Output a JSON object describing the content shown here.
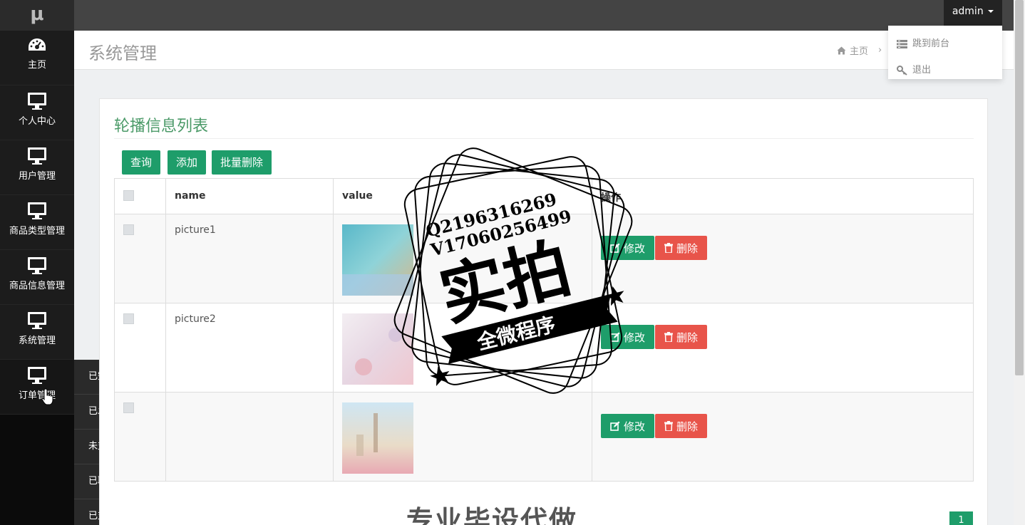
{
  "sidebar": {
    "logo": "μ",
    "items": [
      {
        "label": "主页",
        "icon": "dashboard-icon"
      },
      {
        "label": "个人中心",
        "icon": "monitor-icon"
      },
      {
        "label": "用户管理",
        "icon": "monitor-icon"
      },
      {
        "label": "商品类型管理",
        "icon": "monitor-icon"
      },
      {
        "label": "商品信息管理",
        "icon": "monitor-icon"
      },
      {
        "label": "系统管理",
        "icon": "monitor-icon"
      },
      {
        "label": "订单管理",
        "icon": "monitor-icon"
      }
    ],
    "submenu": [
      "已完成订单",
      "已发货订单",
      "未支付订单",
      "已取消订单",
      "已支付订单"
    ]
  },
  "topbar": {
    "user": "admin",
    "dropdown": [
      {
        "label": "跳到前台",
        "icon": "list-icon"
      },
      {
        "label": "退出",
        "icon": "key-icon"
      }
    ]
  },
  "header": {
    "title": "系统管理",
    "breadcrumb_home": "主页",
    "breadcrumb_sep": "›"
  },
  "panel": {
    "title": "轮播信息列表",
    "buttons": {
      "query": "查询",
      "add": "添加",
      "batch_delete": "批量删除"
    },
    "columns": [
      "name",
      "value",
      "操作"
    ],
    "rows": [
      {
        "name": "picture1"
      },
      {
        "name": "picture2"
      },
      {
        "name": ""
      }
    ],
    "edit_label": "修改",
    "delete_label": "删除",
    "page": "1"
  },
  "watermark": {
    "line1": "Q2196316269",
    "line2": "V17060256499",
    "main": "实拍",
    "ribbon": "全微程序",
    "bottom": "专业毕设代做"
  },
  "colors": {
    "accent": "#1e9d6a",
    "danger": "#e8544a",
    "title_green": "#4b9a68",
    "sidebar_bg": "#1c1c1c",
    "topbar_bg": "#444444"
  }
}
